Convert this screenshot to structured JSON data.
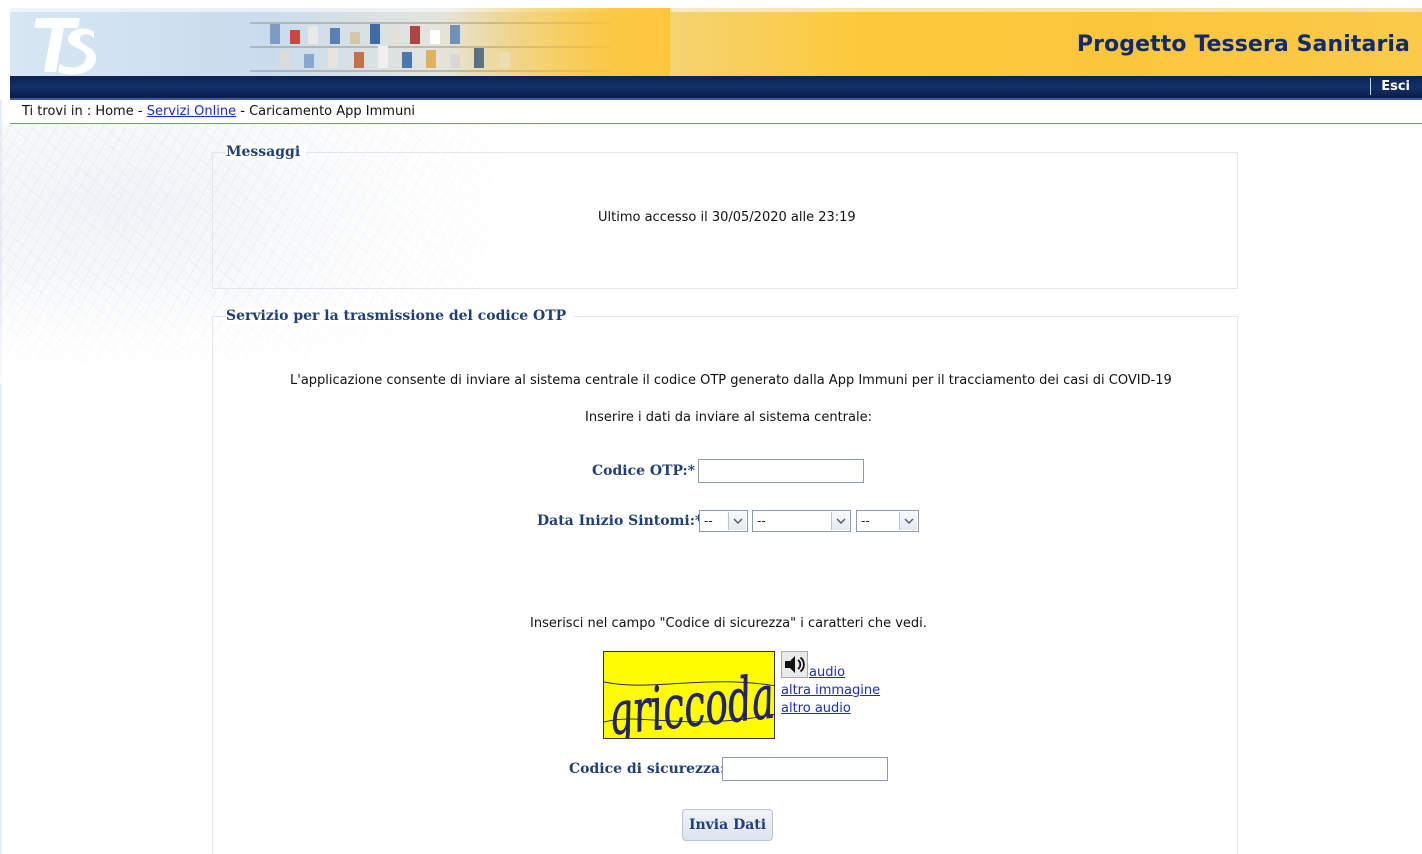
{
  "header": {
    "title": "Progetto Tessera Sanitaria",
    "logout_label": "Esci"
  },
  "breadcrumb": {
    "prefix": "Ti trovi in : Home - ",
    "link": "Servizi Online",
    "separator": " - ",
    "current": "Caricamento App Immuni"
  },
  "messages": {
    "title": "Messaggi",
    "last_access": "Ultimo accesso il 30/05/2020 alle 23:19"
  },
  "service": {
    "title": "Servizio per la trasmissione del codice OTP",
    "description": "L'applicazione consente di inviare al sistema centrale il codice OTP generato dalla App Immuni per il tracciamento dei casi di COVID-19",
    "instruction": "Inserire i dati da inviare al sistema centrale:",
    "otp_label": "Codice OTP:*",
    "otp_value": "",
    "date_label": "Data Inizio Sintomi:*",
    "date_day": "--",
    "date_month": "--",
    "date_year": "--",
    "captcha_instruction": "Inserisci nel campo \"Codice di sicurezza\" i caratteri che vedi.",
    "captcha_text": "griccoda",
    "audio_link": "audio",
    "other_image_link": "altra immagine",
    "other_audio_link": "altro audio",
    "security_label": "Codice di sicurezza:",
    "security_value": "",
    "submit_label": "Invia Dati"
  },
  "icons": {
    "logo": "ts-logo-icon",
    "speaker": "speaker-icon",
    "dropdown": "chevron-down-icon"
  },
  "colors": {
    "navy": "#0b2253",
    "header_yellow": "#fcc63c",
    "label_blue": "#1f3f7a",
    "link_blue": "#1a2bd0",
    "captcha_yellow": "#fffc00"
  }
}
